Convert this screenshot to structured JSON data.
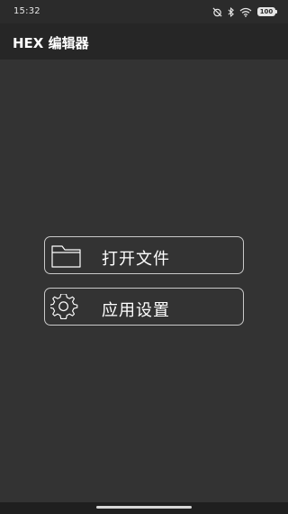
{
  "status_bar": {
    "time": "15:32",
    "battery_level": "100",
    "icons": [
      "alarm-off-icon",
      "bluetooth-icon",
      "wifi-icon",
      "battery-icon"
    ]
  },
  "app_bar": {
    "title": "HEX 编辑器"
  },
  "menu": {
    "open_file_label": "打开文件",
    "open_file_icon": "folder-icon",
    "settings_label": "应用设置",
    "settings_icon": "gear-icon"
  },
  "colors": {
    "background": "#333333",
    "app_bar": "#262626",
    "status_bar": "#2b2b2b",
    "button_border": "#c9c9c9",
    "text": "#ffffff"
  }
}
